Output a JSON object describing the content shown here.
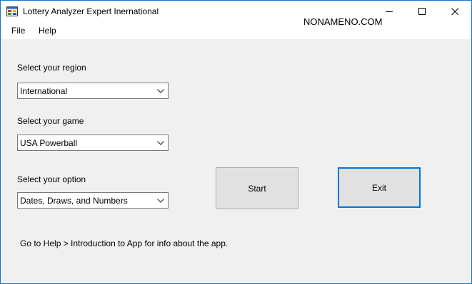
{
  "window": {
    "title": "Lottery Analyzer Expert Inernational",
    "watermark": "NONAMENO.COM",
    "minimize_icon": "minimize-icon",
    "maximize_icon": "maximize-icon",
    "close_icon": "close-icon",
    "accent_color": "#0078d7"
  },
  "menu": {
    "items": [
      {
        "label": "File"
      },
      {
        "label": "Help"
      }
    ]
  },
  "form": {
    "region": {
      "label": "Select your region",
      "value": "International"
    },
    "game": {
      "label": "Select your game",
      "value": "USA Powerball"
    },
    "option": {
      "label": "Select your option",
      "value": "Dates, Draws, and Numbers"
    },
    "start_label": "Start",
    "exit_label": "Exit",
    "info_text": "Go to Help > Introduction to App for info about the app."
  }
}
